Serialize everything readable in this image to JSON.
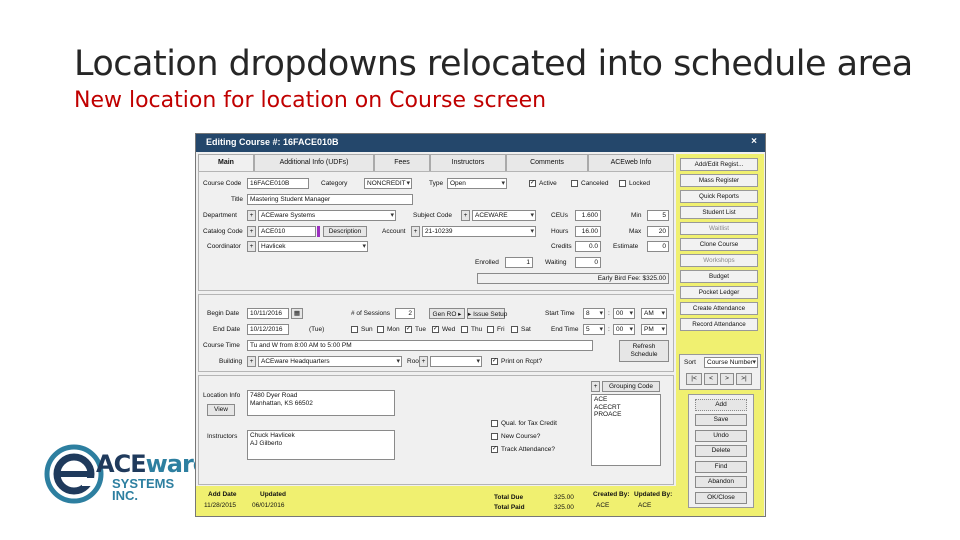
{
  "slide": {
    "title": "Location dropdowns relocated into schedule area",
    "subtitle": "New location for location on Course screen"
  },
  "logo": {
    "ace": "ACE",
    "ware": "ware",
    "sys1": "SYSTEMS",
    "sys2": "INC."
  },
  "window": {
    "title": "Editing Course #: 16FACE010B",
    "close": "×",
    "tabs": [
      "Main",
      "Additional Info (UDFs)",
      "Fees",
      "Instructors",
      "Comments",
      "ACEweb Info"
    ]
  },
  "course": {
    "course_code_label": "Course Code",
    "course_code": "16FACE010B",
    "category_label": "Category",
    "category": "NONCREDIT",
    "type_label": "Type",
    "type": "Open",
    "active_label": "Active",
    "canceled_label": "Canceled",
    "locked_label": "Locked",
    "title_label": "Title",
    "title": "Mastering Student Manager",
    "department_label": "Department",
    "department": "ACEware Systems",
    "subject_code_label": "Subject Code",
    "subject_code": "ACEWARE",
    "ceus_label": "CEUs",
    "ceus": "1.600",
    "min_label": "Min",
    "min": "5",
    "catalog_code_label": "Catalog Code",
    "catalog_code": "ACE010",
    "description_button": "Description",
    "account_label": "Account",
    "account": "21-10239",
    "hours_label": "Hours",
    "hours": "16.00",
    "max_label": "Max",
    "max": "20",
    "coordinator_label": "Coordinator",
    "coordinator": "Havlicek",
    "credits_label": "Credits",
    "credits": "0.0",
    "estimate_label": "Estimate",
    "estimate": "0",
    "enrolled_label": "Enrolled",
    "enrolled": "1",
    "waiting_label": "Waiting",
    "waiting": "0",
    "early_bird": "Early Bird Fee: $325.00"
  },
  "schedule": {
    "begin_date_label": "Begin Date",
    "begin_date": "10/11/2016",
    "num_sessions_label": "# of Sessions",
    "num_sessions": "2",
    "gen_ro_button": "Gen RO",
    "issue_setup_button": "Issue Setup",
    "start_time_label": "Start Time",
    "start_h": "8",
    "start_m": "00",
    "start_ampm": "AM",
    "end_date_label": "End Date",
    "end_date": "10/12/2016",
    "end_day": "(Tue)",
    "days": [
      "Sun",
      "Mon",
      "Tue",
      "Wed",
      "Thu",
      "Fri",
      "Sat"
    ],
    "end_time_label": "End Time",
    "end_h": "5",
    "end_m": "00",
    "end_ampm": "PM",
    "course_time_label": "Course Time",
    "course_time": "Tu and W from 8:00 AM to 5:00 PM",
    "refresh_button": "Refresh Schedule",
    "building_label": "Building",
    "building": "ACEware Headquarters",
    "room_label": "Room",
    "room": "",
    "print_on_rcpt_label": "Print on Rcpt?"
  },
  "lower": {
    "location_info_label": "Location Info",
    "location_line1": "7480 Dyer Road",
    "location_line2": "Manhattan, KS 66502",
    "view_button": "View",
    "instructors_label": "Instructors",
    "instructor1": "Chuck Havlicek",
    "instructor2": "AJ Gilberto",
    "qual_tax_credit_label": "Qual. for Tax Credit",
    "new_course_label": "New Course?",
    "track_attendance_label": "Track Attendance?",
    "grouping_code_label": "Grouping Code",
    "grouping_codes": [
      "ACE",
      "ACECRT",
      "PROACE"
    ]
  },
  "footer": {
    "add_date_label": "Add Date",
    "add_date": "11/28/2015",
    "updated_label": "Updated",
    "updated": "06/01/2016",
    "total_due_label": "Total Due",
    "total_due": "325.00",
    "total_paid_label": "Total Paid",
    "total_paid": "325.00",
    "created_by_label": "Created By:",
    "created_by": "ACE",
    "updated_by_label": "Updated By:",
    "updated_by": "ACE"
  },
  "sidebar": {
    "buttons": [
      "Add/Edit Regist...",
      "Mass Register",
      "Quick Reports",
      "Student List",
      "Waitlist",
      "Clone Course",
      "Workshops",
      "Budget",
      "Pocket Ledger",
      "Create Attendance",
      "Record Attendance"
    ],
    "sort_label": "Sort",
    "sort_value": "Course Number",
    "nav": [
      "|<",
      "<",
      ">",
      ">|"
    ],
    "actions": [
      "Add",
      "Save",
      "Undo",
      "Delete",
      "Find",
      "Abandon",
      "OK/Close"
    ]
  },
  "colors": {
    "titlebar": "#24476b",
    "sidebar": "#f0f070",
    "subtitle": "#c00000"
  }
}
